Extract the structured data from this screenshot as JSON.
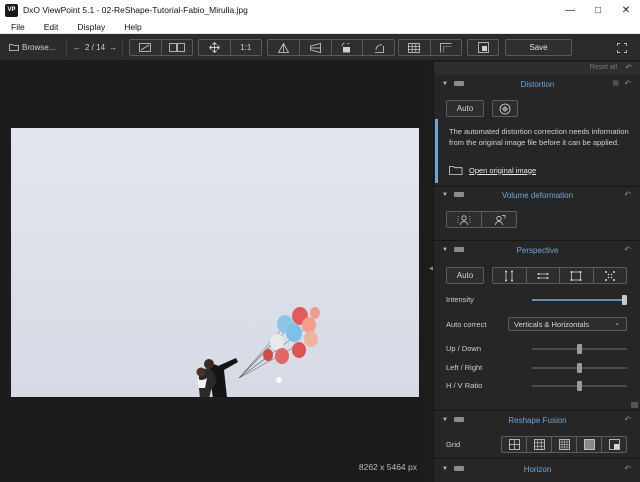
{
  "window": {
    "app_icon": "VP",
    "title": "DxO ViewPoint 5.1 - 02-ReShape-Tutorial-Fabio_Mirulla.jpg",
    "controls": [
      "minimize-icon",
      "maximize-icon",
      "close-icon"
    ]
  },
  "menu": {
    "items": [
      "File",
      "Edit",
      "Display",
      "Help"
    ]
  },
  "toolbar": {
    "browse_label": "Browse...",
    "nav_counter": "2 / 14",
    "compare_one_to_one": "1:1",
    "save_label": "Save"
  },
  "viewer": {
    "image_dimensions": "8262 x 5464 px"
  },
  "panel": {
    "reset_all_label": "Reset all",
    "distortion": {
      "title": "Distortion",
      "auto_label": "Auto",
      "info_message": "The automated distortion correction needs information from the original image file before it can be applied.",
      "open_original_label": "Open original image"
    },
    "volume_deformation": {
      "title": "Volume deformation"
    },
    "perspective": {
      "title": "Perspective",
      "auto_label": "Auto",
      "intensity_label": "Intensity",
      "intensity_value": 1.0,
      "auto_correct_label": "Auto correct",
      "auto_correct_value": "Verticals & Horizontals",
      "up_down_label": "Up / Down",
      "up_down_value": 0.5,
      "left_right_label": "Left / Right",
      "left_right_value": 0.5,
      "hv_ratio_label": "H / V Ratio",
      "hv_ratio_value": 0.5
    },
    "reshape_fusion": {
      "title": "Reshape Fusion",
      "grid_label": "Grid"
    },
    "horizon": {
      "title": "Horizon"
    }
  },
  "colors": {
    "accent": "#6ea6d6",
    "panel_bg": "#262626",
    "viewer_bg": "#1c1c1c",
    "toolbar_bg": "#2b2b2b"
  }
}
